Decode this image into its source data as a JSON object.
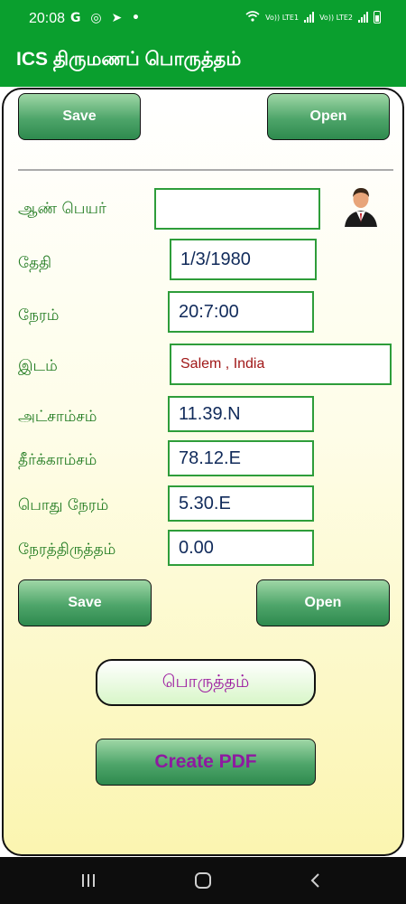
{
  "status_bar": {
    "time": "20:08",
    "left_icons": "G ◎ ➤ •",
    "sim1": "Vo)) LTE1",
    "sim2": "Vo)) LTE2"
  },
  "app_bar": {
    "title": "ICS திருமணப் பொருத்தம்"
  },
  "top_buttons": {
    "save": "Save",
    "open": "Open"
  },
  "form": {
    "name_label": "ஆண் பெயர்",
    "name_value": "",
    "date_label": "தேதி",
    "date_value": "1/3/1980",
    "time_label": "நேரம்",
    "time_value": "20:7:00",
    "place_label": "இடம்",
    "place_value": "Salem , India",
    "latitude_label": "அட்சாம்சம்",
    "latitude_value": "11.39.N",
    "longitude_label": "தீர்க்காம்சம்",
    "longitude_value": "78.12.E",
    "common_time_label": "பொது நேரம்",
    "common_time_value": "5.30.E",
    "time_correction_label": "நேரத்திருத்தம்",
    "time_correction_value": "0.00"
  },
  "bottom_buttons": {
    "save": "Save",
    "open": "Open"
  },
  "porutham_button": "பொருத்தம்",
  "pdf_button": "Create PDF",
  "nav": {
    "recents": "recents-icon",
    "home": "home-icon",
    "back": "back-icon"
  },
  "colors": {
    "accent": "#0a9f2e",
    "label": "#1f7a1f",
    "pdf_text": "#8e1aa0"
  }
}
